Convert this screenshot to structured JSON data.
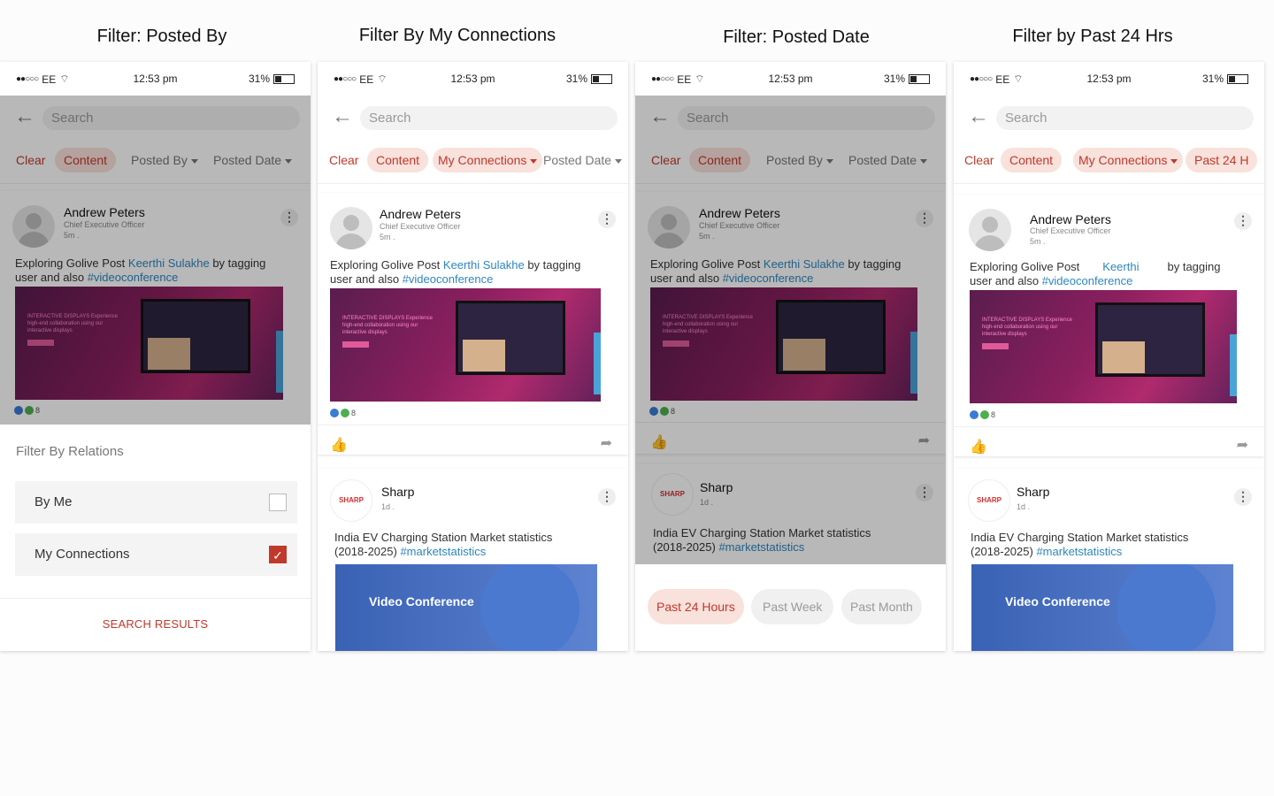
{
  "titles": [
    "Filter: Posted By",
    "Filter By My Connections",
    "Filter: Posted Date",
    "Filter by Past 24 Hrs"
  ],
  "status": {
    "carrier": "EE",
    "time": "12:53 pm",
    "battery": "31%"
  },
  "search_placeholder": "Search",
  "chips": {
    "clear": "Clear",
    "content": "Content",
    "posted_by": "Posted By",
    "posted_date": "Posted Date",
    "my_connections": "My Connections",
    "past_24": "Past 24 H"
  },
  "post1": {
    "author": "Andrew Peters",
    "role": "Chief Executive Officer",
    "time": "5m .",
    "text_before": "Exploring Golive Post",
    "mention": "Keerthi Sulakhe",
    "mention_short": "Keerthi",
    "text_after": "by tagging",
    "text_line2": "user and also",
    "hashtag": "#videoconference",
    "media_text": "INTERACTIVE DISPLAYS Experience high-end collaboration using our interactive displays",
    "reaction_count": "8"
  },
  "post2": {
    "author": "Sharp",
    "logo": "SHARP",
    "time": "1d .",
    "text_line1": "India EV Charging Station Market statistics",
    "text_line2": "(2018-2025)",
    "hashtag": "#marketstatistics",
    "video_text": "Video Conference"
  },
  "filter_sheet": {
    "heading": "Filter By Relations",
    "options": [
      {
        "label": "By Me",
        "checked": false
      },
      {
        "label": "My Connections",
        "checked": true
      }
    ],
    "action": "SEARCH RESULTS"
  },
  "date_options": [
    {
      "label": "Past 24 Hours",
      "selected": true
    },
    {
      "label": "Past Week",
      "selected": false
    },
    {
      "label": "Past Month",
      "selected": false
    }
  ],
  "colors": {
    "accent": "#c0392b",
    "accent_bg": "#f9e1dc",
    "link": "#2e86c1"
  }
}
